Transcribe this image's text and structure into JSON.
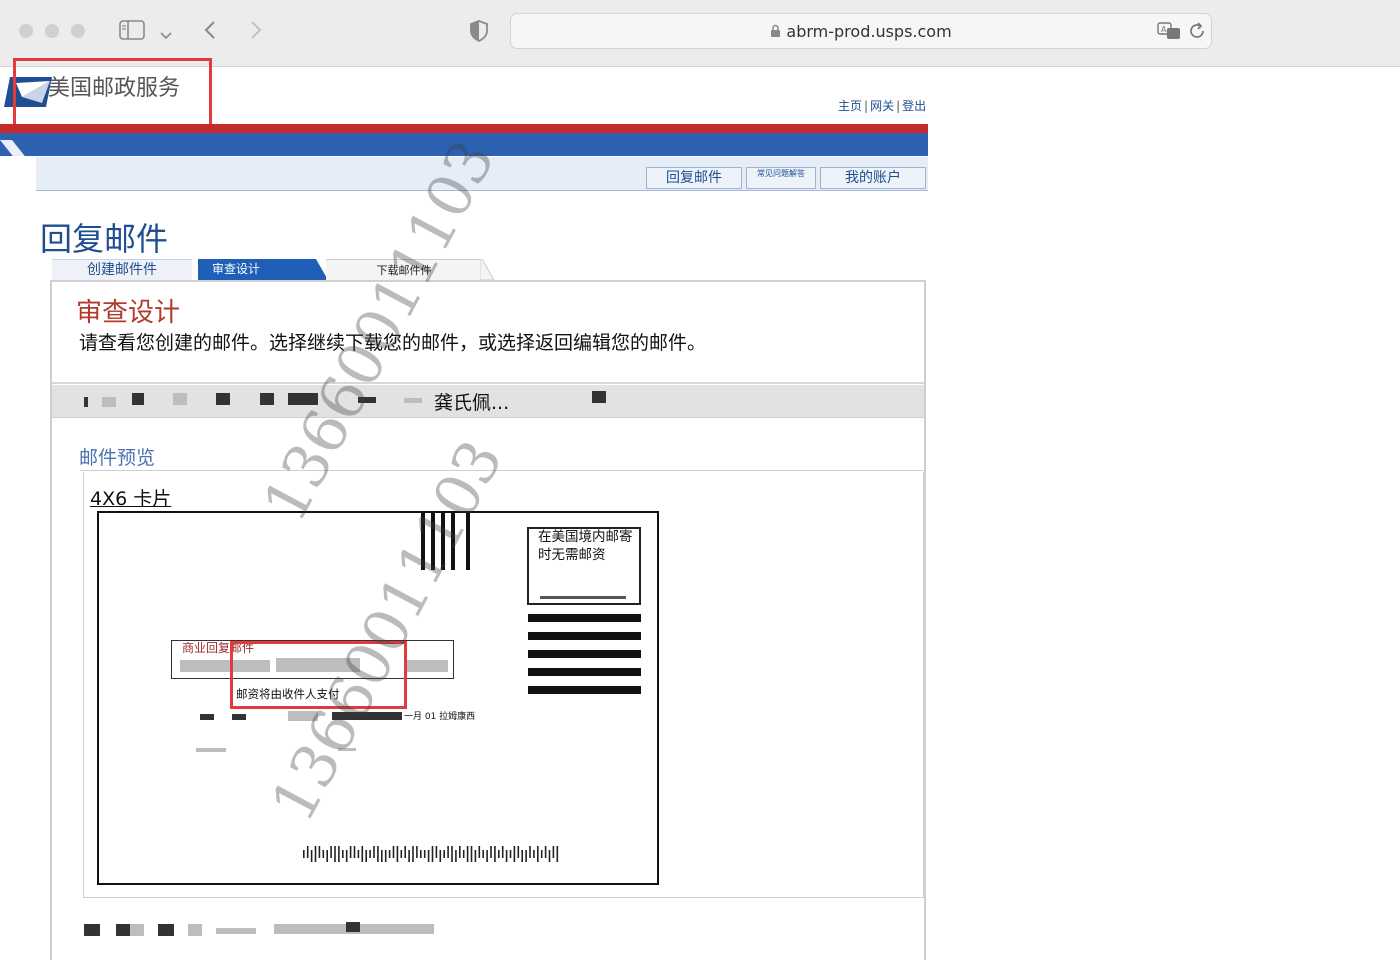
{
  "browser": {
    "url": "abrm-prod.usps.com"
  },
  "site": {
    "brand": "美国邮政服务",
    "top_links": [
      "主页",
      "网关",
      "登出"
    ],
    "nav_tabs": [
      "回复邮件",
      "常见问题解答",
      "我的账户"
    ]
  },
  "page": {
    "title": "回复邮件",
    "steps": [
      "创建邮件件",
      "审查设计",
      "下载邮件件"
    ],
    "active_step": "审查设计"
  },
  "review": {
    "heading": "审查设计",
    "instructions": "请查看您创建的邮件。选择继续下载您的邮件，或选择返回编辑您的邮件。",
    "mailpiece_name": "龚氏佩..."
  },
  "preview": {
    "heading": "邮件预览",
    "card_size": "4X6 卡片",
    "postage_note": "在美国境内邮寄时无需邮资",
    "brm_title": "商业回复邮件",
    "brm_paid_note": "邮资将由收件人支付",
    "brm_date_fragment": "一月 01 拉姆康西"
  },
  "watermark": "13660011103",
  "colors": {
    "usps_blue": "#2d62b3",
    "usps_red": "#c52b2b",
    "highlight_red": "#e23b3b",
    "heading_red": "#b03a2e"
  }
}
